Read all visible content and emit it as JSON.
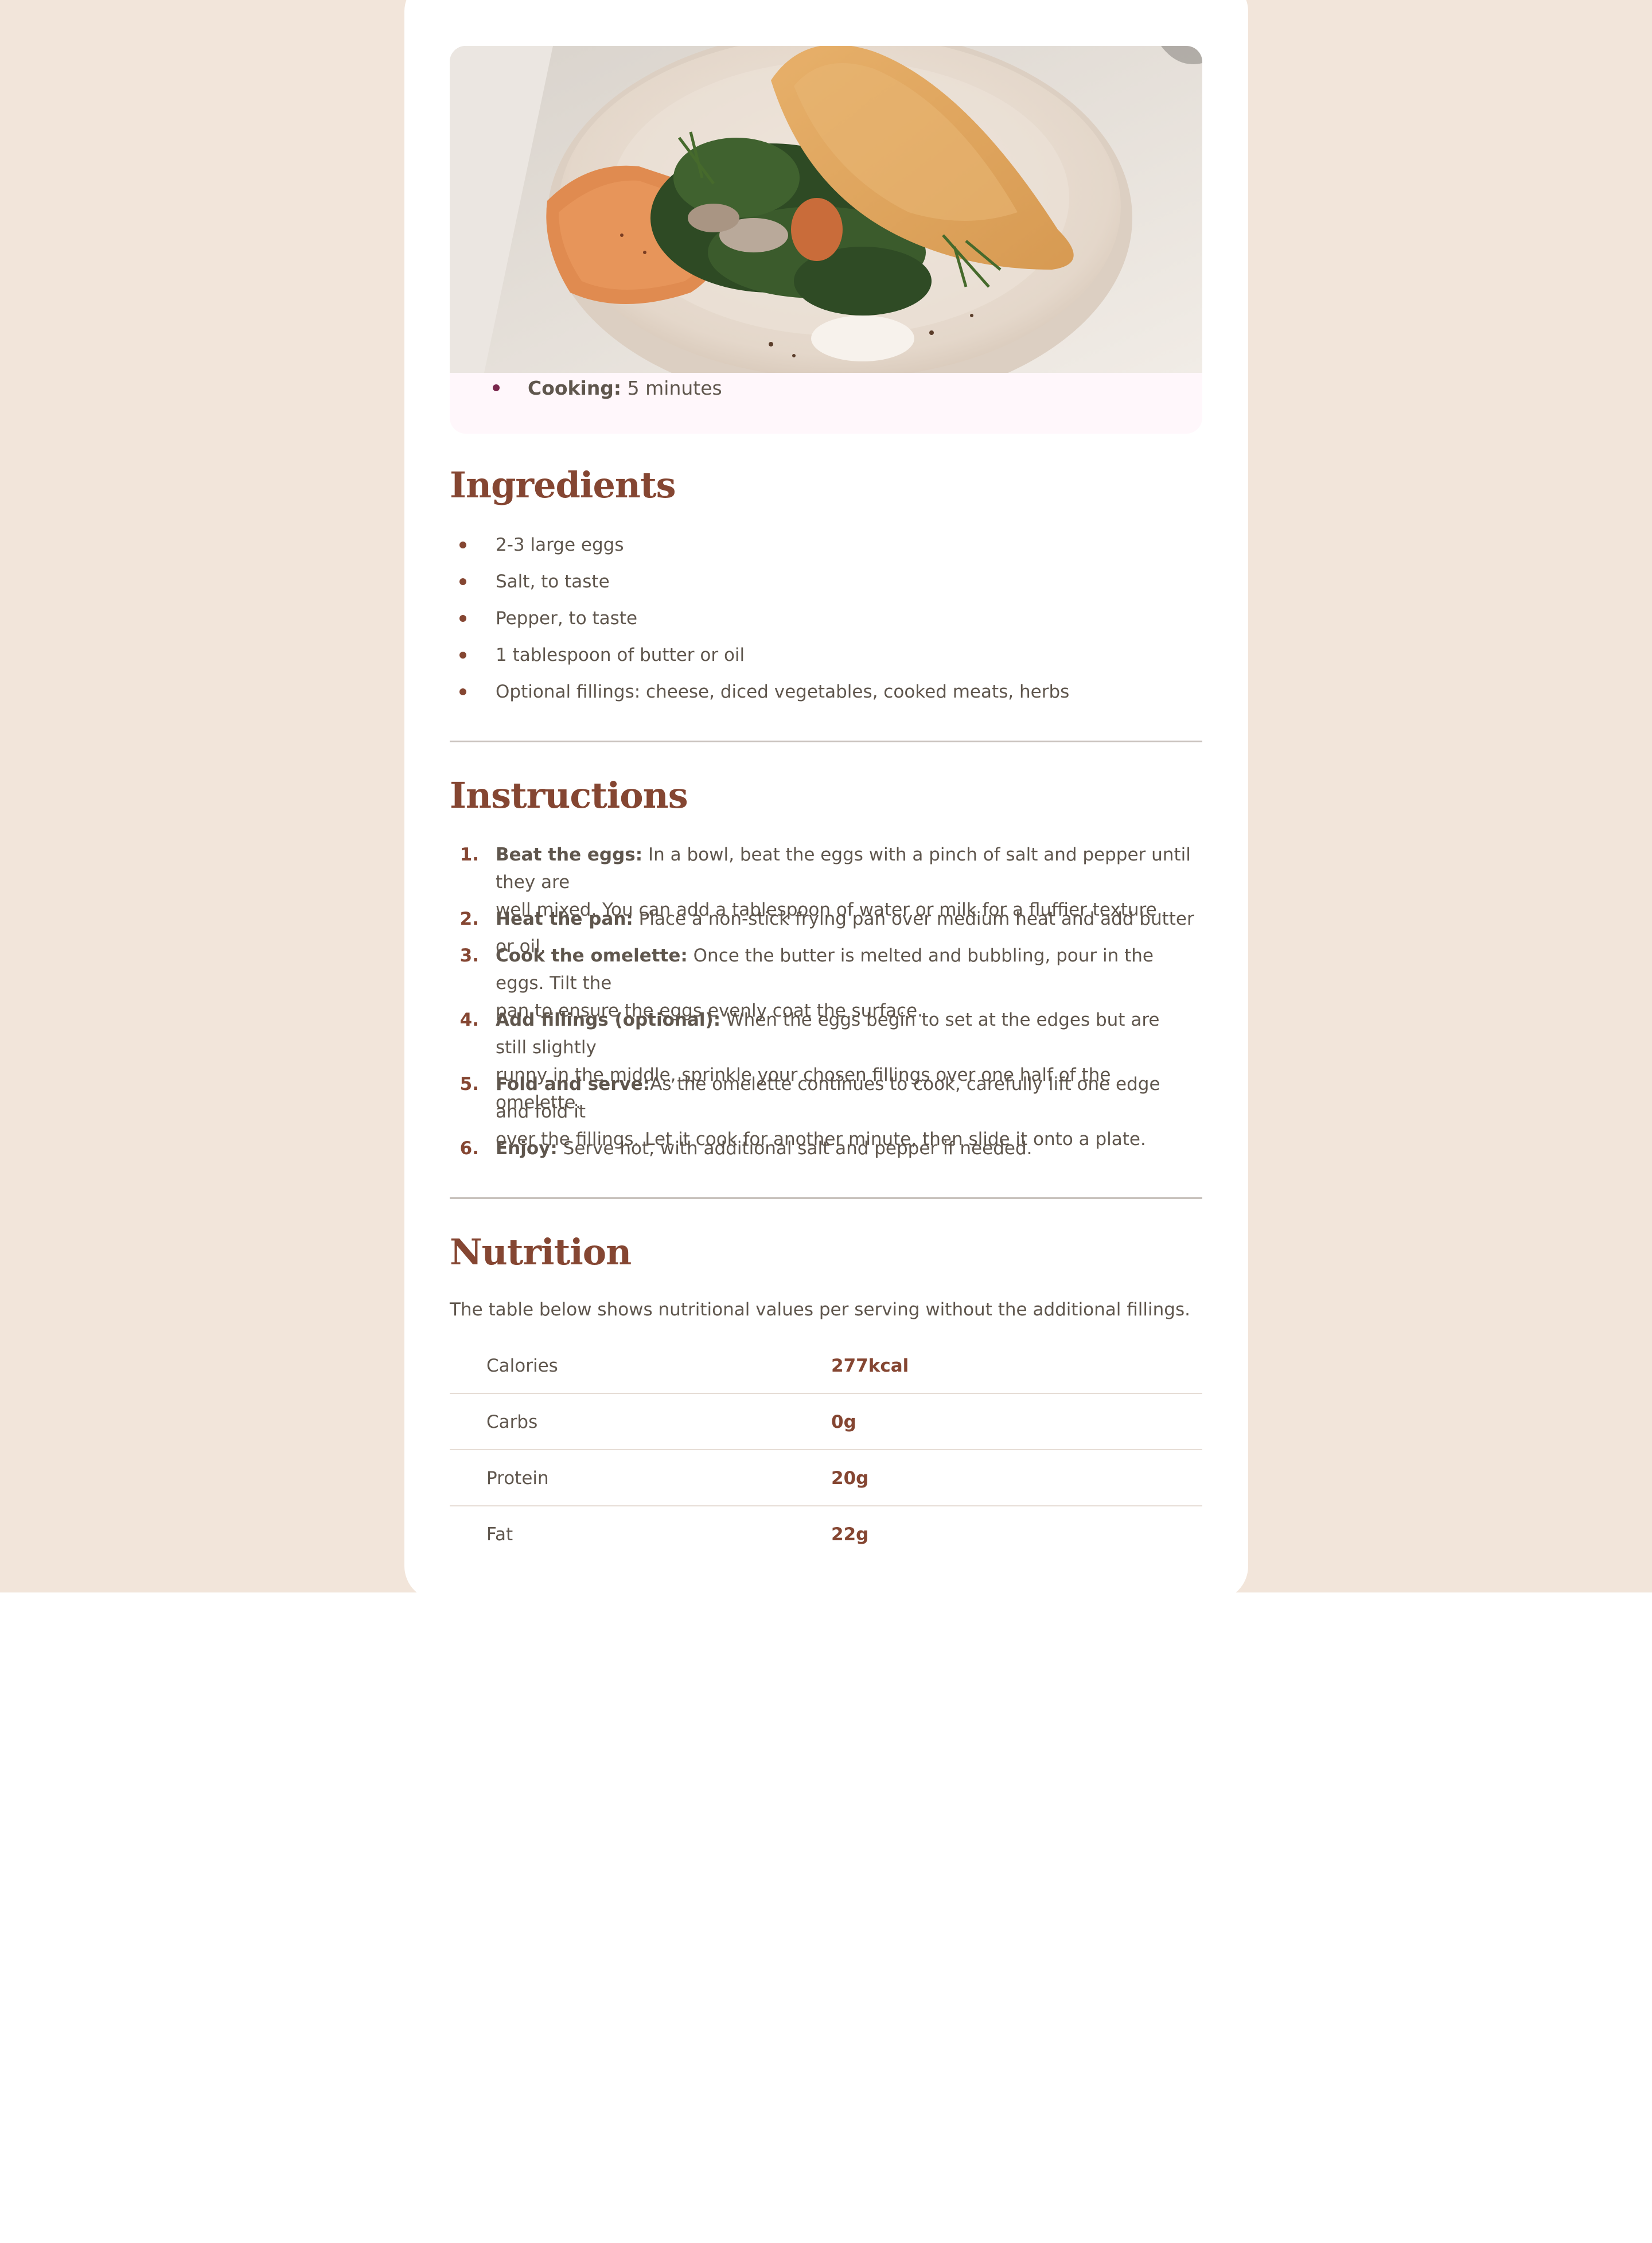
{
  "colors": {
    "page_background": "#f2e5da",
    "card_background": "#ffffff",
    "heading": "#854632",
    "body_text": "#5f564d",
    "prep_box": "#fff7fb",
    "rule": "#c9c2bd"
  },
  "hero": {
    "image_icon": "omelette-photo"
  },
  "preparation": {
    "items": [
      {
        "label": "Cooking:",
        "value": "5 minutes"
      }
    ]
  },
  "ingredients": {
    "heading": "Ingredients",
    "items": [
      "2-3 large eggs",
      "Salt, to taste",
      "Pepper, to taste",
      "1 tablespoon of butter or oil",
      "Optional fillings: cheese, diced vegetables, cooked meats, herbs"
    ]
  },
  "instructions": {
    "heading": "Instructions",
    "steps": [
      {
        "num": "1.",
        "title": "Beat the eggs:",
        "line1": " In a bowl, beat the eggs with a pinch of salt and pepper until they are",
        "line2": "well mixed. You can add a tablespoon of water or milk for a fluffier texture."
      },
      {
        "num": "2.",
        "title": "Heat the pan:",
        "line1": " Place a non-stick frying pan over medium heat and add butter or oil.",
        "line2": ""
      },
      {
        "num": "3.",
        "title": "Cook the omelette:",
        "line1": " Once the butter is melted and bubbling, pour in the eggs. Tilt the",
        "line2": "pan to ensure the eggs evenly coat the surface."
      },
      {
        "num": "4.",
        "title": "Add fillings (optional):",
        "line1": " When the eggs begin to set at the edges but are still slightly",
        "line2": "runny in the middle, sprinkle your chosen fillings over one half of the omelette."
      },
      {
        "num": "5.",
        "title": "Fold and serve:",
        "line1": "As the omelette continues to cook, carefully lift one edge and fold it",
        "line2": "over the fillings. Let it cook for another minute, then slide it onto a plate."
      },
      {
        "num": "6.",
        "title": "Enjoy:",
        "line1": " Serve hot, with additional salt and pepper if needed.",
        "line2": ""
      }
    ]
  },
  "nutrition": {
    "heading": "Nutrition",
    "intro": "The table below shows nutritional values per serving without the additional fillings.",
    "rows": [
      {
        "label": "Calories",
        "value": "277kcal"
      },
      {
        "label": "Carbs",
        "value": "0g"
      },
      {
        "label": "Protein",
        "value": "20g"
      },
      {
        "label": "Fat",
        "value": "22g"
      }
    ]
  }
}
